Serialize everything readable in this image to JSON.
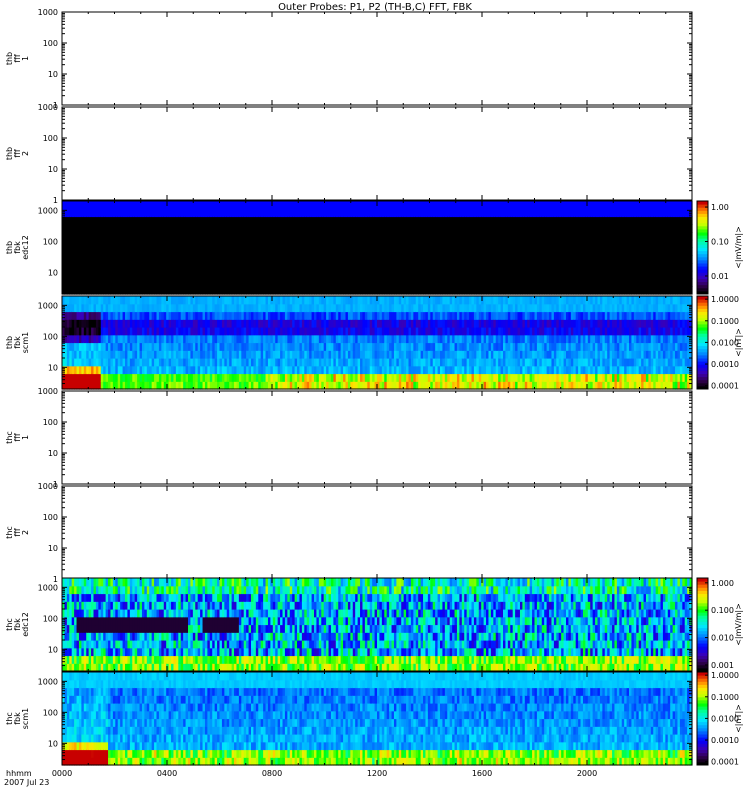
{
  "title": "Outer Probes: P1, P2 (TH-B,C) FFT, FBK",
  "time_axis": {
    "label_top": "hhmm",
    "label_bottom": "2007 Jul 23",
    "ticks": [
      "0000",
      "0400",
      "0800",
      "1200",
      "1600",
      "2000"
    ]
  },
  "chart_data": [
    {
      "type": "heatmap",
      "panel": "thb-fff-1",
      "ylabel": [
        "thb",
        "fff",
        "1"
      ],
      "yscale": "log",
      "ylim": [
        1,
        1000
      ],
      "yticks": [
        "1",
        "10",
        "100",
        "1000"
      ],
      "colorbar": null,
      "data": "empty"
    },
    {
      "type": "heatmap",
      "panel": "thb-fff-2",
      "ylabel": [
        "thb",
        "fff",
        "2"
      ],
      "yscale": "log",
      "ylim": [
        1,
        1000
      ],
      "yticks": [
        "1",
        "10",
        "100",
        "1000"
      ],
      "colorbar": null,
      "data": "empty"
    },
    {
      "type": "heatmap",
      "panel": "thb-fbk-edc12",
      "ylabel": [
        "thb",
        "fbk",
        "edc12"
      ],
      "yscale": "log",
      "ylim": [
        2,
        2000
      ],
      "yticks": [
        "10",
        "100",
        "1000"
      ],
      "colorbar": {
        "label": "<|mV/m|>",
        "scale": "log",
        "range": [
          0.003,
          1.5
        ],
        "ticks": [
          "1.00",
          "0.10",
          "0.01"
        ]
      },
      "data": "uniform: ~0.005 mV/m (black) across 2-1000 Hz, ~0.02 mV/m (blue) in top band, all day"
    },
    {
      "type": "heatmap",
      "panel": "thb-fbk-scm1",
      "ylabel": [
        "thb",
        "fbk",
        "scm1"
      ],
      "yscale": "log",
      "ylim": [
        2,
        2000
      ],
      "yticks": [
        "10",
        "100",
        "1000"
      ],
      "colorbar": {
        "label": "<|nT|>",
        "scale": "log",
        "range": [
          7e-05,
          1.4
        ],
        "ticks": [
          "1.0000",
          "0.1000",
          "0.0100",
          "0.0010",
          "0.0001"
        ]
      },
      "data": "higher amplitude near 0000-0130 at low frequencies; broadband ~0.001-0.01 nT background"
    },
    {
      "type": "heatmap",
      "panel": "thc-fff-1",
      "ylabel": [
        "thc",
        "fff",
        "1"
      ],
      "yscale": "log",
      "ylim": [
        1,
        1000
      ],
      "yticks": [
        "1",
        "10",
        "100",
        "1000"
      ],
      "colorbar": null,
      "data": "empty"
    },
    {
      "type": "heatmap",
      "panel": "thc-fff-2",
      "ylabel": [
        "thc",
        "fff",
        "2"
      ],
      "yscale": "log",
      "ylim": [
        1,
        1000
      ],
      "yticks": [
        "1",
        "10",
        "100",
        "1000"
      ],
      "colorbar": null,
      "data": "empty"
    },
    {
      "type": "heatmap",
      "panel": "thc-fbk-edc12",
      "ylabel": [
        "thc",
        "fbk",
        "edc12"
      ],
      "yscale": "log",
      "ylim": [
        2,
        2000
      ],
      "yticks": [
        "10",
        "100",
        "1000"
      ],
      "colorbar": {
        "label": "<|mV/m|>",
        "scale": "log",
        "range": [
          0.0006,
          1.5
        ],
        "ticks": [
          "1.000",
          "0.100",
          "0.010",
          "0.001"
        ]
      },
      "data": "variable broadband fields; quiet gap near 0000-0200 and 0400-0530 around 50 Hz"
    },
    {
      "type": "heatmap",
      "panel": "thc-fbk-scm1",
      "ylabel": [
        "thc",
        "fbk",
        "scm1"
      ],
      "yscale": "log",
      "ylim": [
        2,
        2000
      ],
      "yticks": [
        "10",
        "100",
        "1000"
      ],
      "colorbar": {
        "label": "<|nT|>",
        "scale": "log",
        "range": [
          7e-05,
          1.4
        ],
        "ticks": [
          "1.0000",
          "0.1000",
          "0.0100",
          "0.0010",
          "0.0001"
        ]
      },
      "data": "strong low-frequency power near 0000-0200; broadband background elsewhere"
    }
  ]
}
